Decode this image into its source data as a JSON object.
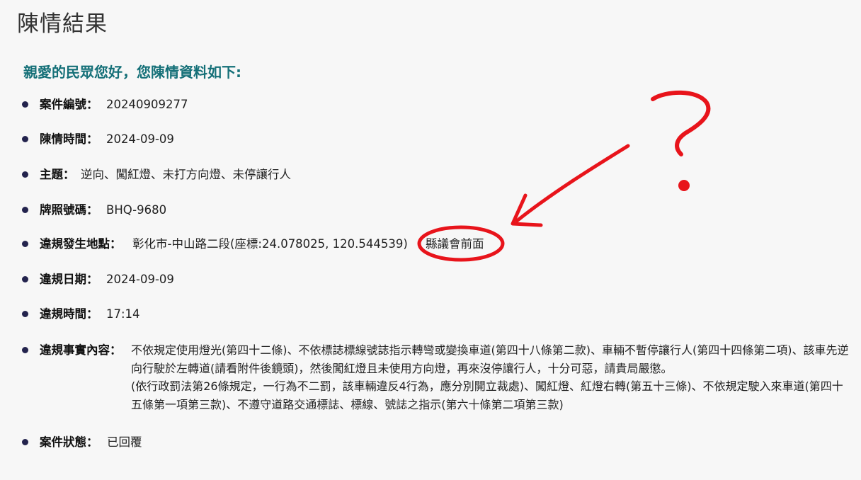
{
  "page": {
    "title": "陳情結果",
    "greeting": "親愛的民眾您好，您陳情資料如下:"
  },
  "items": {
    "case_number": {
      "label": "案件編號：",
      "value": "20240909277"
    },
    "petition_time": {
      "label": "陳情時間：",
      "value": "2024-09-09"
    },
    "subject": {
      "label": "主題：",
      "value": "逆向、闖紅燈、未打方向燈、未停讓行人"
    },
    "plate": {
      "label": "牌照號碼：",
      "value": "BHQ-9680"
    },
    "location": {
      "label": "違規發生地點：",
      "value": "彰化市-中山路二段(座標:24.078025, 120.544539)",
      "note": "縣議會前面"
    },
    "violation_date": {
      "label": "違規日期：",
      "value": "2024-09-09"
    },
    "violation_time": {
      "label": "違規時間：",
      "value": "17:14"
    },
    "facts": {
      "label": "違規事實內容：",
      "paragraph1": "不依規定使用燈光(第四十二條)、不依標誌標線號誌指示轉彎或變換車道(第四十八條第二款)、車輛不暫停讓行人(第四十四條第二項)、該車先逆向行駛於左轉道(請看附件後鏡頭)，然後闖紅燈且未使用方向燈，再來沒停讓行人，十分可惡，請貴局嚴懲。",
      "paragraph2": "(依行政罰法第26條規定，一行為不二罰，該車輛違反4行為，應分別開立裁處)、闖紅燈、紅燈右轉(第五十三條)、不依規定駛入來車道(第四十五條第一項第三款)、不遵守道路交通標誌、標線、號誌之指示(第六十條第二項第三款)"
    },
    "status": {
      "label": "案件狀態：",
      "value": "已回覆"
    }
  },
  "annotation": {
    "mark": "?",
    "color": "#e8141b"
  }
}
